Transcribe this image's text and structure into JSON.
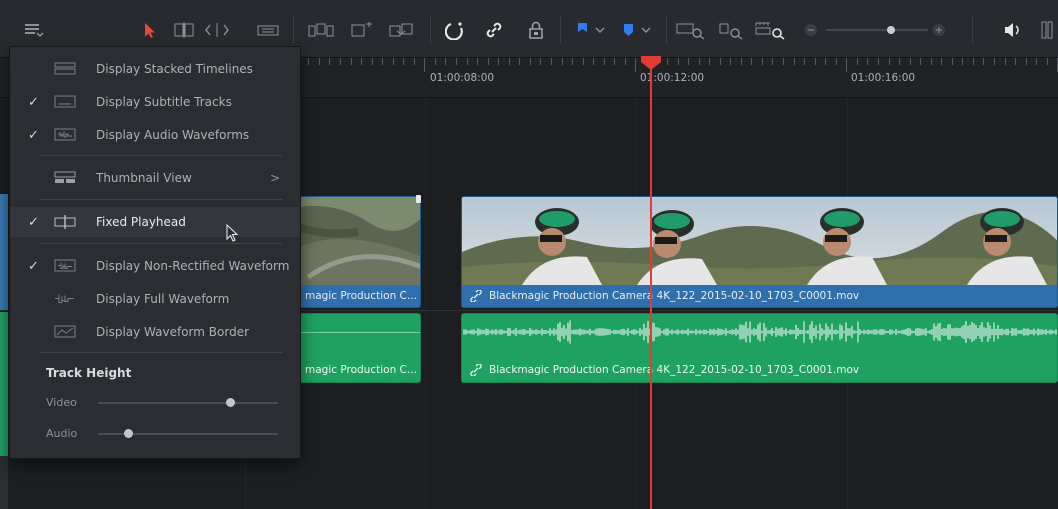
{
  "timeline": {
    "timecodes": [
      "01:00:08:00",
      "01:00:12:00",
      "01:00:16:00"
    ]
  },
  "clips": {
    "video_left_label": "magic Production C...",
    "video_main_label": "Blackmagic Production Camera 4K_122_2015-02-10_1703_C0001.mov",
    "audio_left_label": "magic Production C...",
    "audio_main_label": "Blackmagic Production Camera 4K_122_2015-02-10_1703_C0001.mov"
  },
  "menu": {
    "items": [
      {
        "label": "Display Stacked Timelines",
        "checked": false,
        "icon": "stacked-timelines-icon"
      },
      {
        "label": "Display Subtitle Tracks",
        "checked": true,
        "icon": "subtitle-tracks-icon"
      },
      {
        "label": "Display Audio Waveforms",
        "checked": true,
        "icon": "audio-waveforms-icon"
      },
      {
        "label": "Thumbnail View",
        "checked": false,
        "icon": "thumbnail-view-icon",
        "submenu": ">"
      },
      {
        "label": "Fixed Playhead",
        "checked": true,
        "icon": "fixed-playhead-icon",
        "highlighted": true
      },
      {
        "label": "Display Non-Rectified Waveform",
        "checked": true,
        "icon": "non-rectified-waveform-icon"
      },
      {
        "label": "Display Full Waveform",
        "checked": false,
        "icon": "full-waveform-icon"
      },
      {
        "label": "Display Waveform Border",
        "checked": false,
        "icon": "waveform-border-icon"
      }
    ],
    "check_glyph": "✓",
    "track_height_title": "Track Height",
    "video_label": "Video",
    "audio_label": "Audio",
    "video_height": 0.75,
    "audio_height": 0.15
  },
  "toolbar": {
    "zoom_level": 0.65
  },
  "colors": {
    "playhead": "#e23d34",
    "video_clip": "#3a79b5",
    "audio_clip": "#1fa162",
    "flag_blue": "#2f7bf0",
    "selection_arrow": "#e8493f"
  }
}
